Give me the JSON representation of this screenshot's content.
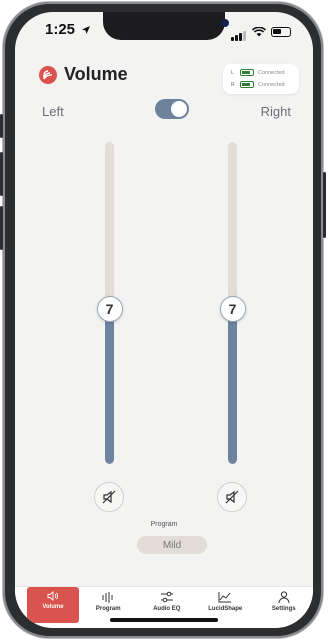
{
  "status": {
    "time": "1:25"
  },
  "header": {
    "title": "Volume"
  },
  "connection": {
    "left": {
      "side": "L",
      "status": "Connected"
    },
    "right": {
      "side": "R",
      "status": "Connected"
    }
  },
  "channels": {
    "left_label": "Left",
    "right_label": "Right",
    "link_toggle_on": true
  },
  "sliders": {
    "left": {
      "value": "7",
      "level_fraction": 0.48
    },
    "right": {
      "value": "7",
      "level_fraction": 0.48
    }
  },
  "program": {
    "label": "Program",
    "value": "Mild"
  },
  "tabs": [
    {
      "label": "Volume",
      "icon": "speaker-icon",
      "active": true
    },
    {
      "label": "Program",
      "icon": "equalizer-bars-icon",
      "active": false
    },
    {
      "label": "Audio EQ",
      "icon": "sliders-icon",
      "active": false
    },
    {
      "label": "LucidShape",
      "icon": "curve-chart-icon",
      "active": false
    },
    {
      "label": "Settings",
      "icon": "person-icon",
      "active": false
    }
  ],
  "colors": {
    "accent": "#d9534f",
    "slider_fill": "#6c84a0",
    "slider_track": "#e3ddd5",
    "battery": "#2e7d32"
  }
}
